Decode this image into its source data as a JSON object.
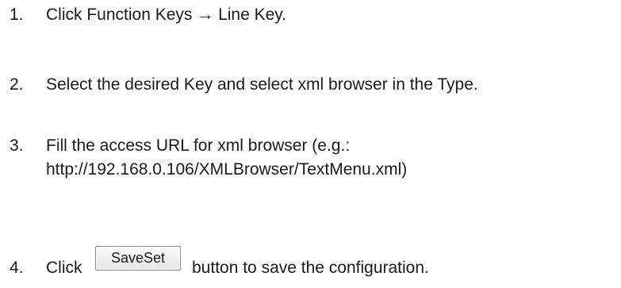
{
  "steps": [
    {
      "number": "1.",
      "text": "Click Function Keys → Line Key."
    },
    {
      "number": "2.",
      "text": "Select the desired Key and select xml browser in the Type."
    },
    {
      "number": "3.",
      "text": "Fill the access URL for xml browser (e.g.:",
      "text_line2": "http://192.168.0.106/XMLBrowser/TextMenu.xml)"
    },
    {
      "number": "4.",
      "text_before": "Click",
      "button_label": "SaveSet",
      "text_after": "button to save the configuration."
    }
  ]
}
